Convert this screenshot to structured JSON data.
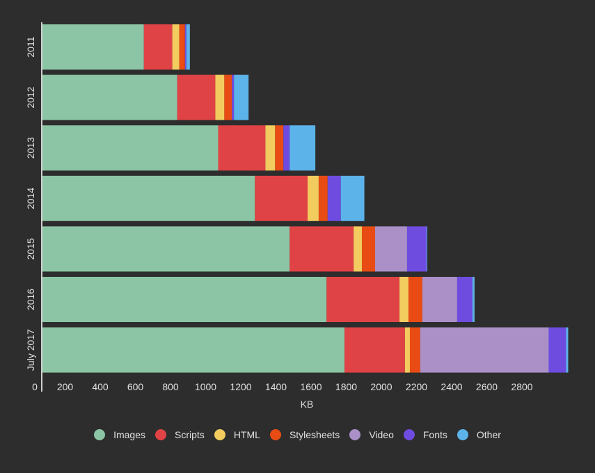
{
  "chart_data": {
    "type": "bar",
    "orientation": "horizontal",
    "stacked": true,
    "title": "",
    "xlabel": "KB",
    "ylabel": "",
    "xlim": [
      0,
      3000
    ],
    "x_ticks": [
      "0",
      "200",
      "400",
      "600",
      "800",
      "1000",
      "1200",
      "1400",
      "1600",
      "1800",
      "2000",
      "2200",
      "2400",
      "2600",
      "2800"
    ],
    "categories": [
      "2011",
      "2012",
      "2013",
      "2014",
      "2015",
      "2016",
      "July 2017"
    ],
    "legend_position": "bottom",
    "series": [
      {
        "name": "Images",
        "color": "#8cc5a5",
        "values": [
          577,
          767,
          1000,
          1209,
          1407,
          1617,
          1719
        ]
      },
      {
        "name": "Scripts",
        "color": "#e04346",
        "values": [
          162,
          217,
          269,
          300,
          364,
          415,
          344
        ]
      },
      {
        "name": "HTML",
        "color": "#f2cc5f",
        "values": [
          40,
          51,
          55,
          63,
          47,
          51,
          28
        ]
      },
      {
        "name": "Stylesheets",
        "color": "#e84c14",
        "values": [
          32,
          43,
          47,
          51,
          75,
          79,
          59
        ]
      },
      {
        "name": "Video",
        "color": "#ab90c8",
        "values": [
          0,
          0,
          0,
          0,
          182,
          198,
          731
        ]
      },
      {
        "name": "Fonts",
        "color": "#6e4cdf",
        "values": [
          8,
          12,
          36,
          75,
          111,
          87,
          99
        ]
      },
      {
        "name": "Other",
        "color": "#5cb3ea",
        "values": [
          20,
          83,
          146,
          134,
          4,
          12,
          12
        ]
      }
    ]
  }
}
